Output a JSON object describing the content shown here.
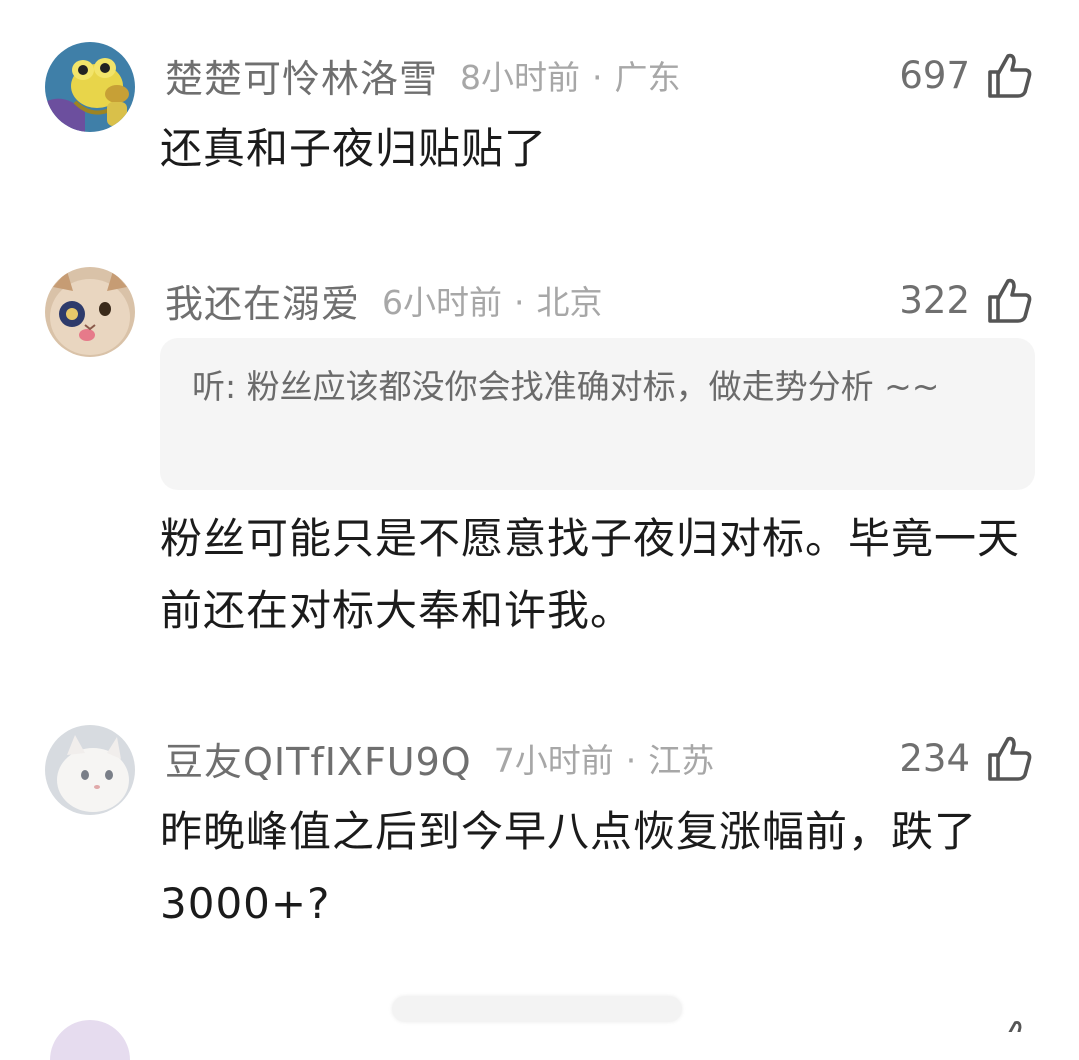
{
  "comments": [
    {
      "username": "楚楚可怜林洛雪",
      "time": "8小时前",
      "location": "广东",
      "likes": "697",
      "avatar_icon": "frog-character-avatar",
      "text": "还真和子夜归贴贴了"
    },
    {
      "username": "我还在溺爱",
      "time": "6小时前",
      "location": "北京",
      "likes": "322",
      "avatar_icon": "cat-avatar",
      "quote": "听: 粉丝应该都没你会找准确对标，做走势分析 ~~",
      "text": "粉丝可能只是不愿意找子夜归对标。毕竟一天前还在对标大奉和许我。"
    },
    {
      "username": "豆友QITfIXFU9Q",
      "time": "7小时前",
      "location": "江苏",
      "likes": "234",
      "avatar_icon": "white-kitten-avatar",
      "text": "昨晚峰值之后到今早八点恢复涨幅前，跌了3000+?"
    }
  ],
  "meta_separator": "·",
  "like_icon": "thumbs-up-icon"
}
